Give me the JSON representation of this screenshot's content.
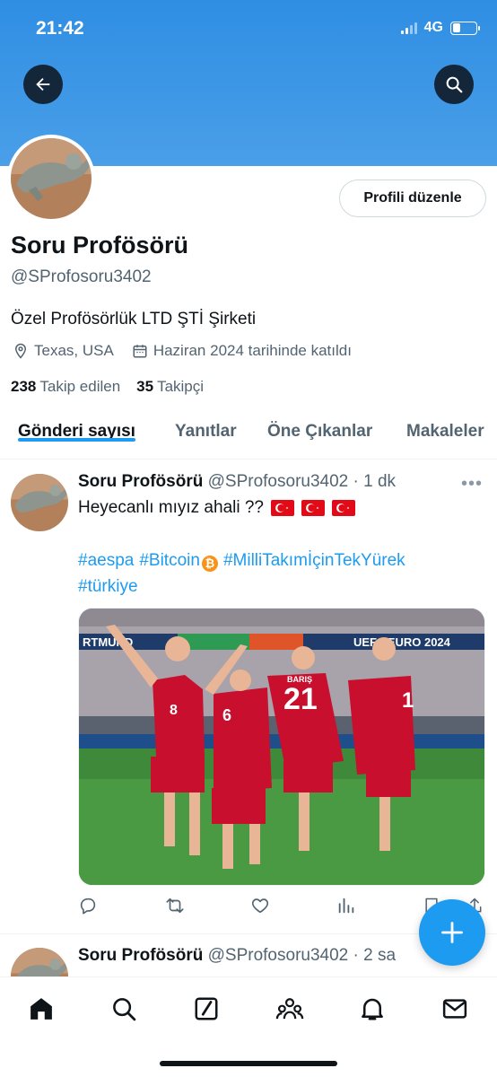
{
  "status_bar": {
    "time": "21:42",
    "network": "4G"
  },
  "profile": {
    "display_name": "Soru Profösörü",
    "handle": "@SProfosoru3402",
    "bio": "Özel Profösörlük LTD ŞTİ Şirketi",
    "location": "Texas, USA",
    "joined": "Haziran 2024 tarihinde katıldı",
    "following_count": "238",
    "following_label": "Takip edilen",
    "followers_count": "35",
    "followers_label": "Takipçi",
    "edit_button": "Profili düzenle"
  },
  "tabs": [
    {
      "label": "Gönderi sayısı",
      "active": true
    },
    {
      "label": "Yanıtlar",
      "active": false
    },
    {
      "label": "Öne Çıkanlar",
      "active": false
    },
    {
      "label": "Makaleler",
      "active": false
    }
  ],
  "posts": [
    {
      "author": "Soru Profösörü",
      "handle": "@SProfosoru3402",
      "time": "· 1 dk",
      "text": "Heyecanlı mıyız ahali ??",
      "hashtags": [
        "#aespa",
        "#Bitcoin",
        "#MilliTakımİçinTekYürek",
        "#türkiye"
      ],
      "media": {
        "banner_left": "RTMUND",
        "banner_right": "UEFA EURO 2024",
        "jersey_numbers": [
          "8",
          "6",
          "21",
          "1"
        ],
        "jersey_name": "BARIŞ"
      }
    },
    {
      "author": "Soru Profösörü",
      "handle": "@SProfosoru3402",
      "time": "· 2 sa"
    }
  ],
  "colors": {
    "accent": "#1d9bf0",
    "banner": "#3a95e6",
    "text_primary": "#0f1419",
    "text_secondary": "#536471"
  },
  "icons": {
    "back": "arrow-left-icon",
    "search": "search-icon",
    "location": "location-pin-icon",
    "calendar": "calendar-icon",
    "reply": "reply-icon",
    "repost": "repost-icon",
    "like": "heart-icon",
    "views": "views-icon",
    "bookmark": "bookmark-icon",
    "share": "share-icon",
    "compose": "plus-icon",
    "nav": [
      "home-icon",
      "search-icon",
      "grok-icon",
      "communities-icon",
      "notifications-icon",
      "messages-icon"
    ]
  }
}
